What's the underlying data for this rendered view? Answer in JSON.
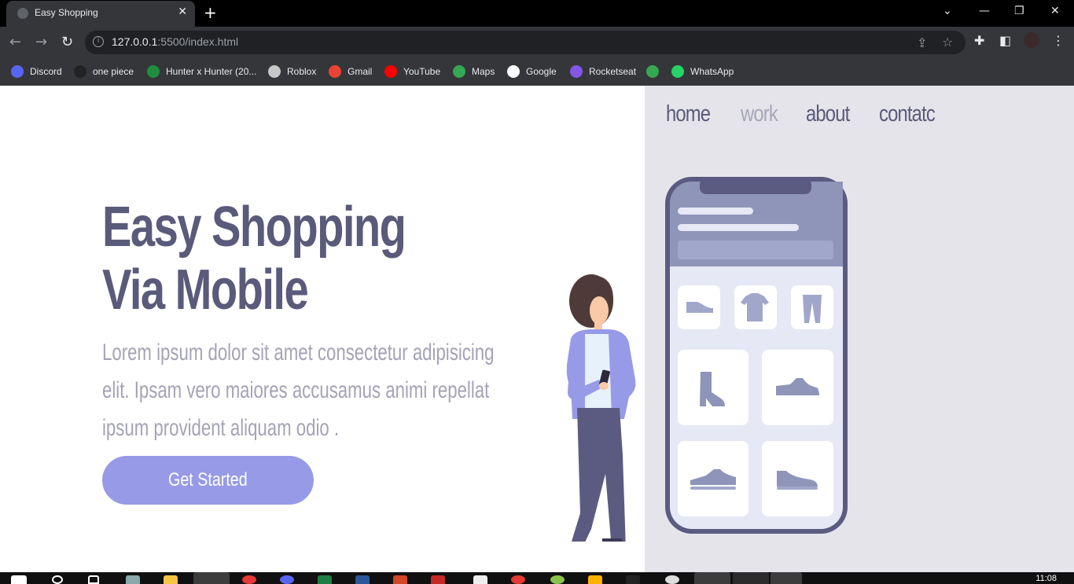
{
  "browser": {
    "tab_title": "Easy Shopping",
    "url_host": "127.0.0.1",
    "url_rest": ":5500/index.html",
    "bookmarks": [
      {
        "label": "Discord",
        "icon": "discord-icon",
        "color": "#5865f2"
      },
      {
        "label": "one piece",
        "icon": "one-piece-icon",
        "color": "#222222"
      },
      {
        "label": "Hunter x Hunter (20...",
        "icon": "anime-icon",
        "color": "#1e8e3e"
      },
      {
        "label": "Roblox",
        "icon": "roblox-icon",
        "color": "#c7c7c7"
      },
      {
        "label": "Gmail",
        "icon": "gmail-icon",
        "color": "#ea4335"
      },
      {
        "label": "YouTube",
        "icon": "youtube-icon",
        "color": "#ff0000"
      },
      {
        "label": "Maps",
        "icon": "maps-icon",
        "color": "#34a853"
      },
      {
        "label": "Google",
        "icon": "google-icon",
        "color": "#ffffff"
      },
      {
        "label": "Rocketseat",
        "icon": "rocketseat-icon",
        "color": "#8257e5"
      },
      {
        "label": "",
        "icon": "phone-icon",
        "color": "#34a853"
      },
      {
        "label": "WhatsApp",
        "icon": "whatsapp-icon",
        "color": "#25d366"
      }
    ]
  },
  "nav": {
    "items": [
      {
        "label": "home",
        "muted": false
      },
      {
        "label": "work",
        "muted": true
      },
      {
        "label": "about",
        "muted": false
      },
      {
        "label": "contatc",
        "muted": false
      }
    ]
  },
  "hero": {
    "title_line1": "Easy Shopping",
    "title_line2": "Via Mobile",
    "text": "Lorem ipsum dolor sit amet consectetur adipisicing elit. Ipsam vero maiores accusamus animi repellat ipsum provident aliquam odio .",
    "cta_label": "Get Started"
  },
  "taskbar": {
    "clock": "11:08"
  },
  "colors": {
    "accent": "#979ae6",
    "heading": "#5a5a7a",
    "body_text": "#a4a3b6",
    "panel": "#e5e4ea",
    "phone_frame": "#5b5b82",
    "phone_header": "#8e95b8"
  }
}
